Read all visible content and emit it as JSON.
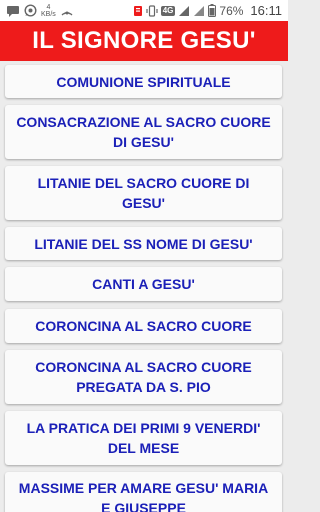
{
  "status_bar": {
    "netspeed_value": "4",
    "netspeed_unit": "KB/s",
    "network_badge": "4G",
    "battery_percent": "76%",
    "time": "16:11",
    "icons": [
      "messages-icon",
      "whatsapp-icon",
      "netspeed-indicator",
      "hotspot-icon",
      "notification-icon",
      "vibrate-icon",
      "signal-icon",
      "signal-icon",
      "battery-icon"
    ]
  },
  "app_bar": {
    "title": "IL SIGNORE GESU'",
    "color": "#ee1b1b"
  },
  "menu": {
    "text_color": "#1b20b8",
    "items": [
      {
        "label": "COMUNIONE SPIRITUALE"
      },
      {
        "label": "CONSACRAZIONE AL SACRO CUORE DI GESU'"
      },
      {
        "label": "LITANIE DEL SACRO CUORE DI GESU'"
      },
      {
        "label": "LITANIE DEL SS NOME DI GESU'"
      },
      {
        "label": "CANTI A GESU'"
      },
      {
        "label": "CORONCINA AL SACRO CUORE"
      },
      {
        "label": "CORONCINA AL SACRO CUORE PREGATA DA S. PIO"
      },
      {
        "label": "LA PRATICA DEI PRIMI 9 VENERDI' DEL MESE"
      },
      {
        "label": "MASSIME PER AMARE GESU' MARIA E GIUSEPPE"
      }
    ]
  }
}
